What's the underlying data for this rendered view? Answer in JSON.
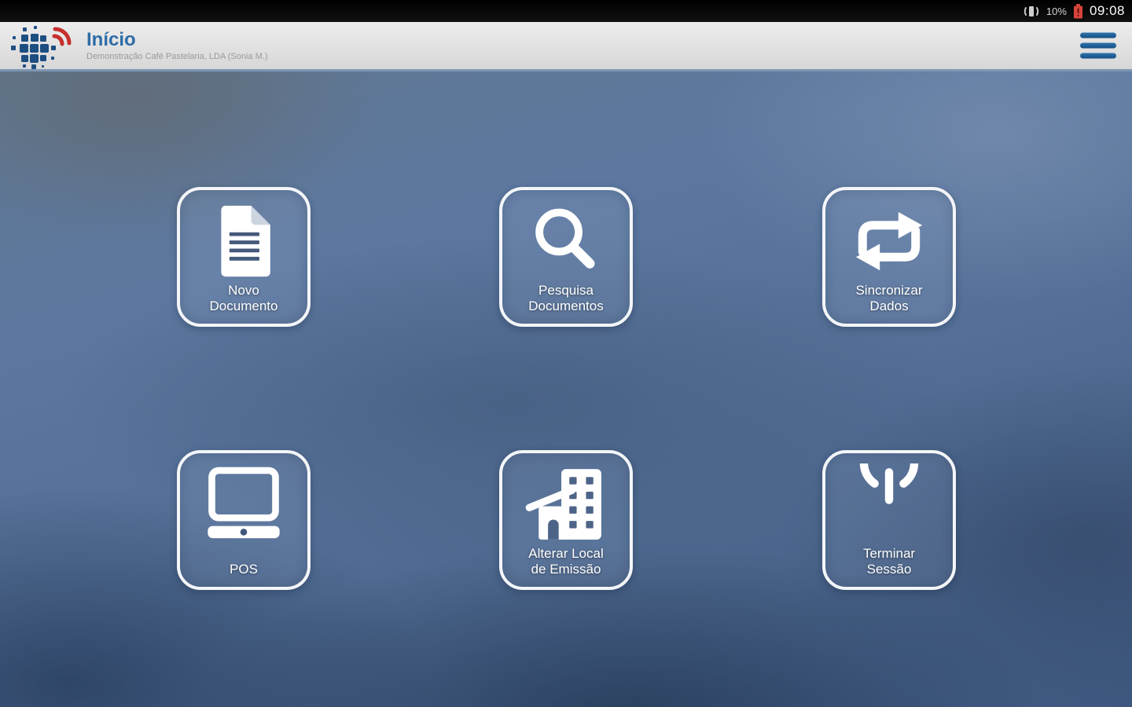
{
  "status_bar": {
    "battery_percent": "10%",
    "time": "09:08"
  },
  "header": {
    "title": "Início",
    "subtitle": "Demonstração Café Pastelaria, LDA (Sonia M.)"
  },
  "tiles": [
    {
      "name": "novo-documento",
      "line1": "Novo",
      "line2": "Documento",
      "icon": "new-document-icon"
    },
    {
      "name": "pesquisa-documentos",
      "line1": "Pesquisa",
      "line2": "Documentos",
      "icon": "search-icon"
    },
    {
      "name": "sincronizar-dados",
      "line1": "Sincronizar",
      "line2": "Dados",
      "icon": "sync-icon"
    },
    {
      "name": "pos",
      "line1": "POS",
      "line2": "",
      "icon": "pos-monitor-icon"
    },
    {
      "name": "alterar-local-de-emissao",
      "line1": "Alterar Local",
      "line2": "de Emissão",
      "icon": "building-icon"
    },
    {
      "name": "terminar-sessao",
      "line1": "Terminar",
      "line2": "Sessão",
      "icon": "power-icon"
    }
  ],
  "colors": {
    "title_blue": "#2e6ca6",
    "logo_blue": "#1d4e82",
    "logo_red": "#c62f2c",
    "battery_red": "#d7443b",
    "tile_border": "#f3f5f8",
    "header_divider": "#7e96b3"
  }
}
